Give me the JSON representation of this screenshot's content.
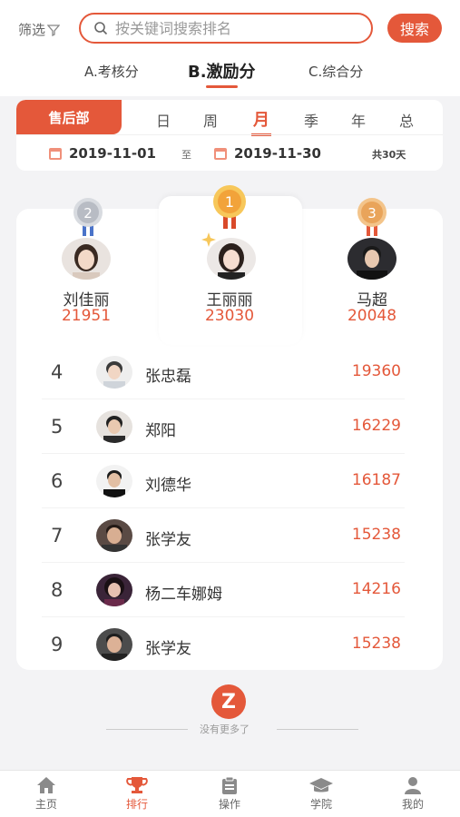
{
  "header": {
    "filter_label": "筛选",
    "search_placeholder": "按关键词搜索排名",
    "search_button": "搜索"
  },
  "score_tabs": [
    {
      "label": "A.考核分",
      "active": false
    },
    {
      "label": "B.激励分",
      "active": true
    },
    {
      "label": "C.综合分",
      "active": false
    }
  ],
  "period": {
    "department": "售后部",
    "tabs": [
      "日",
      "周",
      "月",
      "季",
      "年",
      "总"
    ],
    "active_tab": "月",
    "start_date": "2019-11-01",
    "separator": "至",
    "end_date": "2019-11-30",
    "total_days": "共30天"
  },
  "podium": [
    {
      "rank": "2",
      "name": "刘佳丽",
      "score": "21951"
    },
    {
      "rank": "1",
      "name": "王丽丽",
      "score": "23030"
    },
    {
      "rank": "3",
      "name": "马超",
      "score": "20048"
    }
  ],
  "ranking": [
    {
      "rank": "4",
      "name": "张忠磊",
      "score": "19360"
    },
    {
      "rank": "5",
      "name": "郑阳",
      "score": "16229"
    },
    {
      "rank": "6",
      "name": "刘德华",
      "score": "16187"
    },
    {
      "rank": "7",
      "name": "张学友",
      "score": "15238"
    },
    {
      "rank": "8",
      "name": "杨二车娜姆",
      "score": "14216"
    },
    {
      "rank": "9",
      "name": "张学友",
      "score": "15238"
    }
  ],
  "footer": {
    "no_more": "没有更多了",
    "logo_letter": "Z"
  },
  "nav": [
    {
      "label": "主页",
      "icon": "home-icon",
      "active": false
    },
    {
      "label": "排行",
      "icon": "trophy-icon",
      "active": true
    },
    {
      "label": "操作",
      "icon": "clipboard-icon",
      "active": false
    },
    {
      "label": "学院",
      "icon": "graduation-cap-icon",
      "active": false
    },
    {
      "label": "我的",
      "icon": "user-icon",
      "active": false
    }
  ],
  "colors": {
    "accent": "#e4583a",
    "gold": "#f2a33a",
    "silver": "#b8bcc4",
    "bronze": "#e9a45a"
  }
}
